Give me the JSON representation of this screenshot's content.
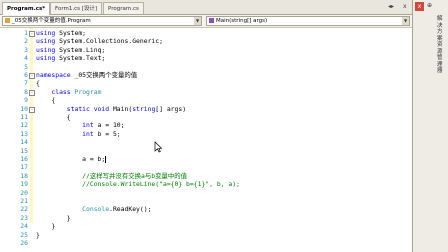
{
  "tabs": [
    {
      "label": "Program.cs*",
      "active": true
    },
    {
      "label": "Form1.cs [设计]",
      "active": false
    },
    {
      "label": "Program.cs",
      "active": false
    }
  ],
  "tab_controls": {
    "scroll": "◂▸",
    "close": "x"
  },
  "nav": {
    "class_combo": "_05交换两个变量的值.Program",
    "member_combo": "Main(string[] args)"
  },
  "editor": {
    "lines": [
      {
        "n": "1",
        "fold": "-",
        "html": "<span class=\"kw\">using</span> System;"
      },
      {
        "n": "2",
        "fold": "",
        "html": "<span class=\"kw\">using</span> System.Collections.Generic;"
      },
      {
        "n": "3",
        "fold": "",
        "html": "<span class=\"kw\">using</span> System.Linq;"
      },
      {
        "n": "4",
        "fold": "",
        "html": "<span class=\"kw\">using</span> System.Text;"
      },
      {
        "n": "5",
        "fold": "",
        "html": ""
      },
      {
        "n": "6",
        "fold": "-",
        "html": "<span class=\"kw\">namespace</span> _05交换两个变量的值"
      },
      {
        "n": "7",
        "fold": "",
        "html": "{"
      },
      {
        "n": "8",
        "fold": "-",
        "html": "    <span class=\"kw\">class</span> <span class=\"ty\">Program</span>"
      },
      {
        "n": "9",
        "fold": "",
        "html": "    {"
      },
      {
        "n": "10",
        "fold": "-",
        "html": "        <span class=\"kw\">static void</span> Main(<span class=\"kw\">string</span>[] args)"
      },
      {
        "n": "11",
        "fold": "",
        "html": "        {"
      },
      {
        "n": "12",
        "fold": "",
        "html": "            <span class=\"kw\">int</span> a = 10;"
      },
      {
        "n": "13",
        "fold": "",
        "html": "            <span class=\"kw\">int</span> b = 5;"
      },
      {
        "n": "14",
        "fold": "",
        "html": ""
      },
      {
        "n": "15",
        "fold": "",
        "html": ""
      },
      {
        "n": "16",
        "fold": "",
        "html": "            a = b;<span class=\"caret\"></span>"
      },
      {
        "n": "17",
        "fold": "",
        "html": ""
      },
      {
        "n": "18",
        "fold": "",
        "html": "            <span class=\"cm\">//这样写并没有交换a与b变量中的值</span>"
      },
      {
        "n": "19",
        "fold": "",
        "html": "            <span class=\"cm\">//Console.WriteLine(\"a={0} b={1}\", b, a);</span>"
      },
      {
        "n": "20",
        "fold": "",
        "html": ""
      },
      {
        "n": "21",
        "fold": "",
        "html": ""
      },
      {
        "n": "22",
        "fold": "",
        "html": "            <span class=\"ty\">Console</span>.ReadKey();"
      },
      {
        "n": "23",
        "fold": "",
        "html": "        }"
      },
      {
        "n": "24",
        "fold": "",
        "html": "    }"
      },
      {
        "n": "25",
        "fold": "",
        "html": "}"
      },
      {
        "n": "26",
        "fold": "",
        "html": ""
      }
    ]
  },
  "right_panel": {
    "close": "x",
    "pin": "⊕",
    "vertical_title": "解决方案资源管理器"
  },
  "colors": {
    "keyword": "#0000ff",
    "type": "#2b91af",
    "comment": "#008000",
    "line_number": "#2b91af"
  }
}
